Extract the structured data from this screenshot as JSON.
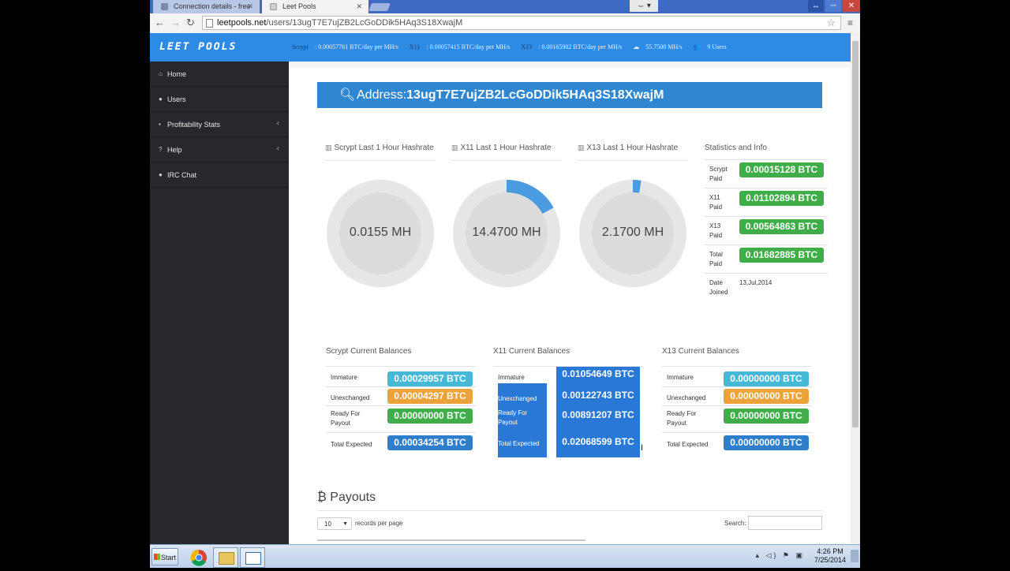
{
  "browser": {
    "tabs": [
      {
        "title": "Connection details - free",
        "active": false
      },
      {
        "title": "Leet Pools",
        "active": true
      }
    ],
    "url_host": "leetpools.net",
    "url_path": "/users/13ugT7E7ujZB2LcGoDDik5HAq3S18XwajM"
  },
  "header": {
    "logo": "LEET POOLS",
    "stats": [
      {
        "label": "Scrypt",
        "value": "0.00057761 BTC/day per MH/s"
      },
      {
        "label": "X11",
        "value": "0.00057415 BTC/day per MH/s"
      },
      {
        "label": "X13",
        "value": "0.00165902 BTC/day per MH/s"
      },
      {
        "label": "",
        "value": "55.7500 MH/s"
      },
      {
        "label": "",
        "value": "9 Users"
      }
    ]
  },
  "sidebar": {
    "items": [
      {
        "label": "Home",
        "icon": "home-icon",
        "has_submenu": false
      },
      {
        "label": "Users",
        "icon": "users-icon",
        "has_submenu": false
      },
      {
        "label": "Profitability Stats",
        "icon": "briefcase-icon",
        "has_submenu": true
      },
      {
        "label": "Help",
        "icon": "question-icon",
        "has_submenu": true
      },
      {
        "label": "IRC Chat",
        "icon": "users-icon",
        "has_submenu": false
      }
    ]
  },
  "address": {
    "label": "Address:",
    "value": "13ugT7E7ujZB2LcGoDDik5HAq3S18XwajM"
  },
  "gauges": [
    {
      "title": "Scrypt Last 1 Hour Hashrate",
      "value": "0.0155 MH",
      "fill_fraction": 0.0
    },
    {
      "title": "X11 Last 1 Hour Hashrate",
      "value": "14.4700 MH",
      "fill_fraction": 0.17
    },
    {
      "title": "X13 Last 1 Hour Hashrate",
      "value": "2.1700 MH",
      "fill_fraction": 0.025
    }
  ],
  "stats_info": {
    "title": "Statistics and Info",
    "rows": [
      {
        "label": "Scrypt Paid",
        "value": "0.00015128 BTC"
      },
      {
        "label": "X11 Paid",
        "value": "0.01102894 BTC"
      },
      {
        "label": "X13 Paid",
        "value": "0.00564863 BTC"
      },
      {
        "label": "Total Paid",
        "value": "0.01682885 BTC"
      },
      {
        "label": "Date Joined",
        "value": "13,Jul,2014"
      }
    ]
  },
  "balances": [
    {
      "title": "Scrypt Current Balances",
      "rows": [
        {
          "label": "Immature",
          "value": "0.00029957 BTC",
          "color": "#45b8d8"
        },
        {
          "label": "Unexchanged",
          "value": "0.00004297 BTC",
          "color": "#eca23a"
        },
        {
          "label": "Ready For Payout",
          "value": "0.00000000 BTC",
          "color": "#3fae48"
        },
        {
          "label": "Total Expected",
          "value": "0.00034254 BTC",
          "color": "#2f7ecc"
        }
      ]
    },
    {
      "title": "X11 Current Balances",
      "rows": [
        {
          "label": "Immature",
          "value": "0.01054649 BTC",
          "color": "#45b8d8"
        },
        {
          "label": "Unexchanged",
          "value": "0.00122743 BTC",
          "color": "#eca23a"
        },
        {
          "label": "Ready For Payout",
          "value": "0.00891207 BTC",
          "color": "#3fae48"
        },
        {
          "label": "Total Expected",
          "value": "0.02068599 BTC",
          "color": "#2f7ecc"
        }
      ]
    },
    {
      "title": "X13 Current Balances",
      "rows": [
        {
          "label": "Immature",
          "value": "0.00000000 BTC",
          "color": "#45b8d8"
        },
        {
          "label": "Unexchanged",
          "value": "0.00000000 BTC",
          "color": "#eca23a"
        },
        {
          "label": "Ready For Payout",
          "value": "0.00000000 BTC",
          "color": "#3fae48"
        },
        {
          "label": "Total Expected",
          "value": "0.00000000 BTC",
          "color": "#2f7ecc"
        }
      ]
    }
  ],
  "payouts": {
    "title": "Payouts",
    "per_page_value": "10",
    "per_page_label": "records per page",
    "search_label": "Search:"
  },
  "taskbar": {
    "start_label": "Start",
    "time": "4:26 PM",
    "date": "7/25/2014"
  },
  "colors": {
    "header_blue": "#2d8be6",
    "sidebar_dark": "#26282d",
    "gauge_fill": "#4a9be0",
    "gauge_track": "#e6e6e6"
  }
}
